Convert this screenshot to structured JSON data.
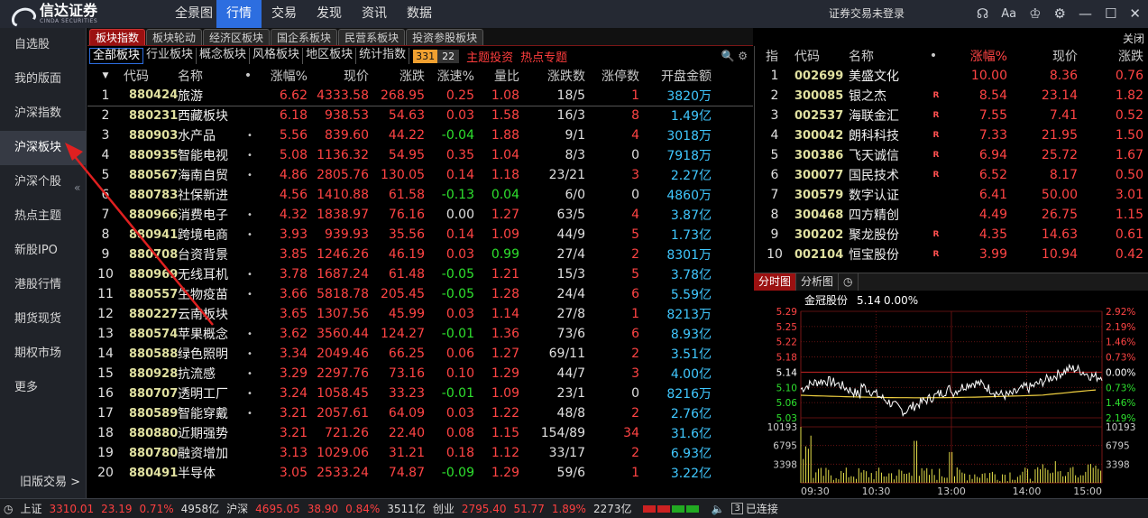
{
  "app": {
    "logo_text": "信达证券",
    "logo_sub": "CINDA SECURITIES",
    "login_status": "证券交易未登录"
  },
  "topnav": [
    "全景图",
    "行情",
    "交易",
    "发现",
    "资讯",
    "数据"
  ],
  "window_icons": [
    "headset-icon",
    "font-size-icon",
    "skin-icon",
    "settings-icon",
    "minimize-icon",
    "maximize-icon",
    "close-icon"
  ],
  "sidebar": {
    "items": [
      "自选股",
      "我的版面",
      "沪深指数",
      "沪深板块",
      "沪深个股",
      "热点主题",
      "新股IPO",
      "港股行情",
      "期货现货",
      "期权市场",
      "更多"
    ],
    "bottom": "旧版交易 >"
  },
  "tabs1": [
    "板块指数",
    "板块轮动",
    "经济区板块",
    "国企系板块",
    "民营系板块",
    "投资参股板块"
  ],
  "close_label": "关闭",
  "tabs2": [
    "全部板块",
    "行业板块",
    "概念板块",
    "风格板块",
    "地区板块",
    "统计指数"
  ],
  "badge": {
    "up": "331",
    "down": "22"
  },
  "tabs2_red": [
    "主题投资",
    "热点专题"
  ],
  "main_table": {
    "headers": [
      "代码",
      "名称",
      "•",
      "涨幅%",
      "现价",
      "涨跌",
      "涨速%",
      "量比",
      "涨跌数",
      "涨停数",
      "开盘金额"
    ],
    "rows": [
      [
        "1",
        "880424",
        "旅游",
        "",
        "6.62",
        "4333.58",
        "268.95",
        "0.25",
        "1.08",
        "18/5",
        "1",
        "3820万"
      ],
      [
        "2",
        "880231",
        "西藏板块",
        "",
        "6.18",
        "938.53",
        "54.63",
        "0.03",
        "1.58",
        "16/3",
        "8",
        "1.49亿"
      ],
      [
        "3",
        "880903",
        "水产品",
        "•",
        "5.56",
        "839.60",
        "44.22",
        "-0.04",
        "1.88",
        "9/1",
        "4",
        "3018万"
      ],
      [
        "4",
        "880935",
        "智能电视",
        "•",
        "5.08",
        "1136.32",
        "54.95",
        "0.35",
        "1.04",
        "8/3",
        "0",
        "7918万"
      ],
      [
        "5",
        "880567",
        "海南自贸",
        "•",
        "4.86",
        "2805.76",
        "130.05",
        "0.14",
        "1.18",
        "23/21",
        "3",
        "2.27亿"
      ],
      [
        "6",
        "880783",
        "社保新进",
        "",
        "4.56",
        "1410.88",
        "61.58",
        "-0.13",
        "0.04",
        "6/0",
        "0",
        "4860万"
      ],
      [
        "7",
        "880966",
        "消费电子",
        "•",
        "4.32",
        "1838.97",
        "76.16",
        "0.00",
        "1.27",
        "63/5",
        "4",
        "3.87亿"
      ],
      [
        "8",
        "880941",
        "跨境电商",
        "•",
        "3.93",
        "939.93",
        "35.56",
        "0.14",
        "1.09",
        "44/9",
        "5",
        "1.73亿"
      ],
      [
        "9",
        "880708",
        "台资背景",
        "",
        "3.85",
        "1246.26",
        "46.19",
        "0.03",
        "0.99",
        "27/4",
        "2",
        "8301万"
      ],
      [
        "10",
        "880969",
        "无线耳机",
        "•",
        "3.78",
        "1687.24",
        "61.48",
        "-0.05",
        "1.21",
        "15/3",
        "5",
        "3.78亿"
      ],
      [
        "11",
        "880557",
        "生物疫苗",
        "•",
        "3.66",
        "5818.78",
        "205.45",
        "-0.05",
        "1.28",
        "24/4",
        "6",
        "5.59亿"
      ],
      [
        "12",
        "880227",
        "云南板块",
        "",
        "3.65",
        "1307.56",
        "45.99",
        "0.03",
        "1.14",
        "27/8",
        "1",
        "8213万"
      ],
      [
        "13",
        "880574",
        "苹果概念",
        "•",
        "3.62",
        "3560.44",
        "124.27",
        "-0.01",
        "1.36",
        "73/6",
        "6",
        "8.93亿"
      ],
      [
        "14",
        "880588",
        "绿色照明",
        "•",
        "3.34",
        "2049.46",
        "66.25",
        "0.06",
        "1.27",
        "69/11",
        "2",
        "3.51亿"
      ],
      [
        "15",
        "880928",
        "抗流感",
        "•",
        "3.29",
        "2297.76",
        "73.16",
        "0.10",
        "1.29",
        "44/7",
        "3",
        "4.00亿"
      ],
      [
        "16",
        "880707",
        "透明工厂",
        "•",
        "3.24",
        "1058.45",
        "33.23",
        "-0.01",
        "1.09",
        "23/1",
        "0",
        "8216万"
      ],
      [
        "17",
        "880589",
        "智能穿戴",
        "•",
        "3.21",
        "2057.61",
        "64.09",
        "0.03",
        "1.22",
        "48/8",
        "2",
        "2.76亿"
      ],
      [
        "18",
        "880880",
        "近期强势",
        "",
        "3.21",
        "721.26",
        "22.40",
        "0.08",
        "1.15",
        "154/89",
        "34",
        "31.6亿"
      ],
      [
        "19",
        "880780",
        "融资增加",
        "",
        "3.13",
        "1029.06",
        "31.21",
        "0.18",
        "1.12",
        "33/17",
        "2",
        "6.93亿"
      ],
      [
        "20",
        "880491",
        "半导体",
        "",
        "3.05",
        "2533.24",
        "74.87",
        "-0.09",
        "1.29",
        "59/6",
        "1",
        "3.22亿"
      ]
    ]
  },
  "right_table": {
    "headers": [
      "指",
      "代码",
      "名称",
      "•",
      "涨幅%",
      "现价",
      "涨跌"
    ],
    "rows": [
      [
        "1",
        "002699",
        "美盛文化",
        "",
        "10.00",
        "8.36",
        "0.76"
      ],
      [
        "2",
        "300085",
        "银之杰",
        "R",
        "8.54",
        "23.14",
        "1.82"
      ],
      [
        "3",
        "002537",
        "海联金汇",
        "R",
        "7.55",
        "7.41",
        "0.52"
      ],
      [
        "4",
        "300042",
        "朗科科技",
        "R",
        "7.33",
        "21.95",
        "1.50"
      ],
      [
        "5",
        "300386",
        "飞天诚信",
        "R",
        "6.94",
        "25.72",
        "1.67"
      ],
      [
        "6",
        "300077",
        "国民技术",
        "R",
        "6.52",
        "8.17",
        "0.50"
      ],
      [
        "7",
        "300579",
        "数字认证",
        "",
        "6.41",
        "50.00",
        "3.01"
      ],
      [
        "8",
        "300468",
        "四方精创",
        "",
        "4.49",
        "26.75",
        "1.15"
      ],
      [
        "9",
        "300202",
        "聚龙股份",
        "R",
        "4.35",
        "14.63",
        "0.61"
      ],
      [
        "10",
        "002104",
        "恒宝股份",
        "R",
        "3.99",
        "10.94",
        "0.42"
      ]
    ]
  },
  "chart_tabs": [
    "分时图",
    "分析图"
  ],
  "chart": {
    "title_name": "金冠股份",
    "title_price": "5.14",
    "title_pct": "0.00%",
    "left_ticks": [
      "5.29",
      "5.25",
      "5.22",
      "5.18",
      "5.14",
      "5.10",
      "5.06",
      "5.03",
      "10193",
      "6795",
      "3398"
    ],
    "right_ticks": [
      "2.92%",
      "2.19%",
      "1.46%",
      "0.73%",
      "0.00%",
      "0.73%",
      "1.46%",
      "2.19%",
      "10193",
      "6795",
      "3398"
    ],
    "x_ticks": [
      "09:30",
      "10:30",
      "13:00",
      "14:00",
      "15:00"
    ],
    "colors": {
      "up": "#ff4444",
      "down": "#2ee02e",
      "price": "#ffffff",
      "avg": "#f0d040",
      "grid": "#7a1616",
      "vol": "#e6e04a"
    }
  },
  "statusbar": {
    "sh_label": "上证",
    "sh_price": "3310.01",
    "sh_chg": "23.19",
    "sh_pct": "0.71%",
    "sh_amt": "4958亿",
    "sz_label": "沪深",
    "sz_price": "4695.05",
    "sz_chg": "38.90",
    "sz_pct": "0.84%",
    "sz_amt": "3511亿",
    "cy_label": "创业",
    "cy_price": "2795.40",
    "cy_chg": "51.77",
    "cy_pct": "1.89%",
    "cy_amt": "2273亿",
    "connection": "已连接",
    "conn_num": "3"
  }
}
